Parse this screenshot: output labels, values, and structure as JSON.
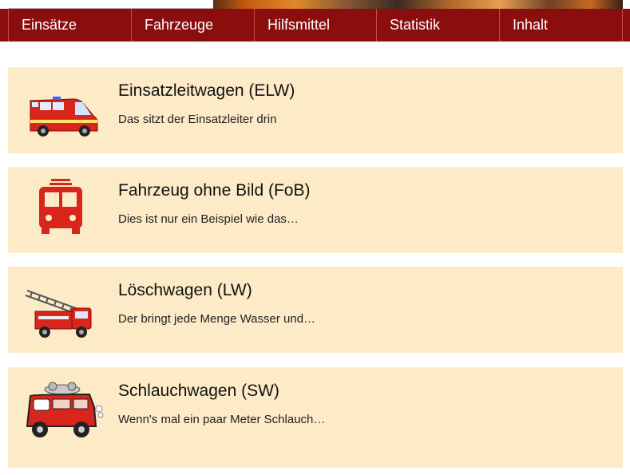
{
  "nav": {
    "tabs": [
      {
        "label": "Einsätze"
      },
      {
        "label": "Fahrzeuge"
      },
      {
        "label": "Hilfsmittel"
      },
      {
        "label": "Statistik"
      },
      {
        "label": "Inhalt"
      }
    ]
  },
  "vehicles": [
    {
      "title": "Einsatzleitwagen (ELW)",
      "description": "Das sitzt der Einsatzleiter drin",
      "icon": "ambulance-van-icon"
    },
    {
      "title": "Fahrzeug ohne Bild (FoB)",
      "description": "Dies ist nur ein Beispiel wie das…",
      "icon": "bus-placeholder-icon"
    },
    {
      "title": "Löschwagen (LW)",
      "description": "Der bringt jede Menge Wasser und…",
      "icon": "ladder-truck-icon"
    },
    {
      "title": "Schlauchwagen (SW)",
      "description": "Wenn's mal ein paar Meter Schlauch…",
      "icon": "cartoon-fire-truck-icon"
    }
  ],
  "colors": {
    "nav_background": "#8b0e0e",
    "card_background": "#fdebc8",
    "icon_red": "#d9261c"
  }
}
